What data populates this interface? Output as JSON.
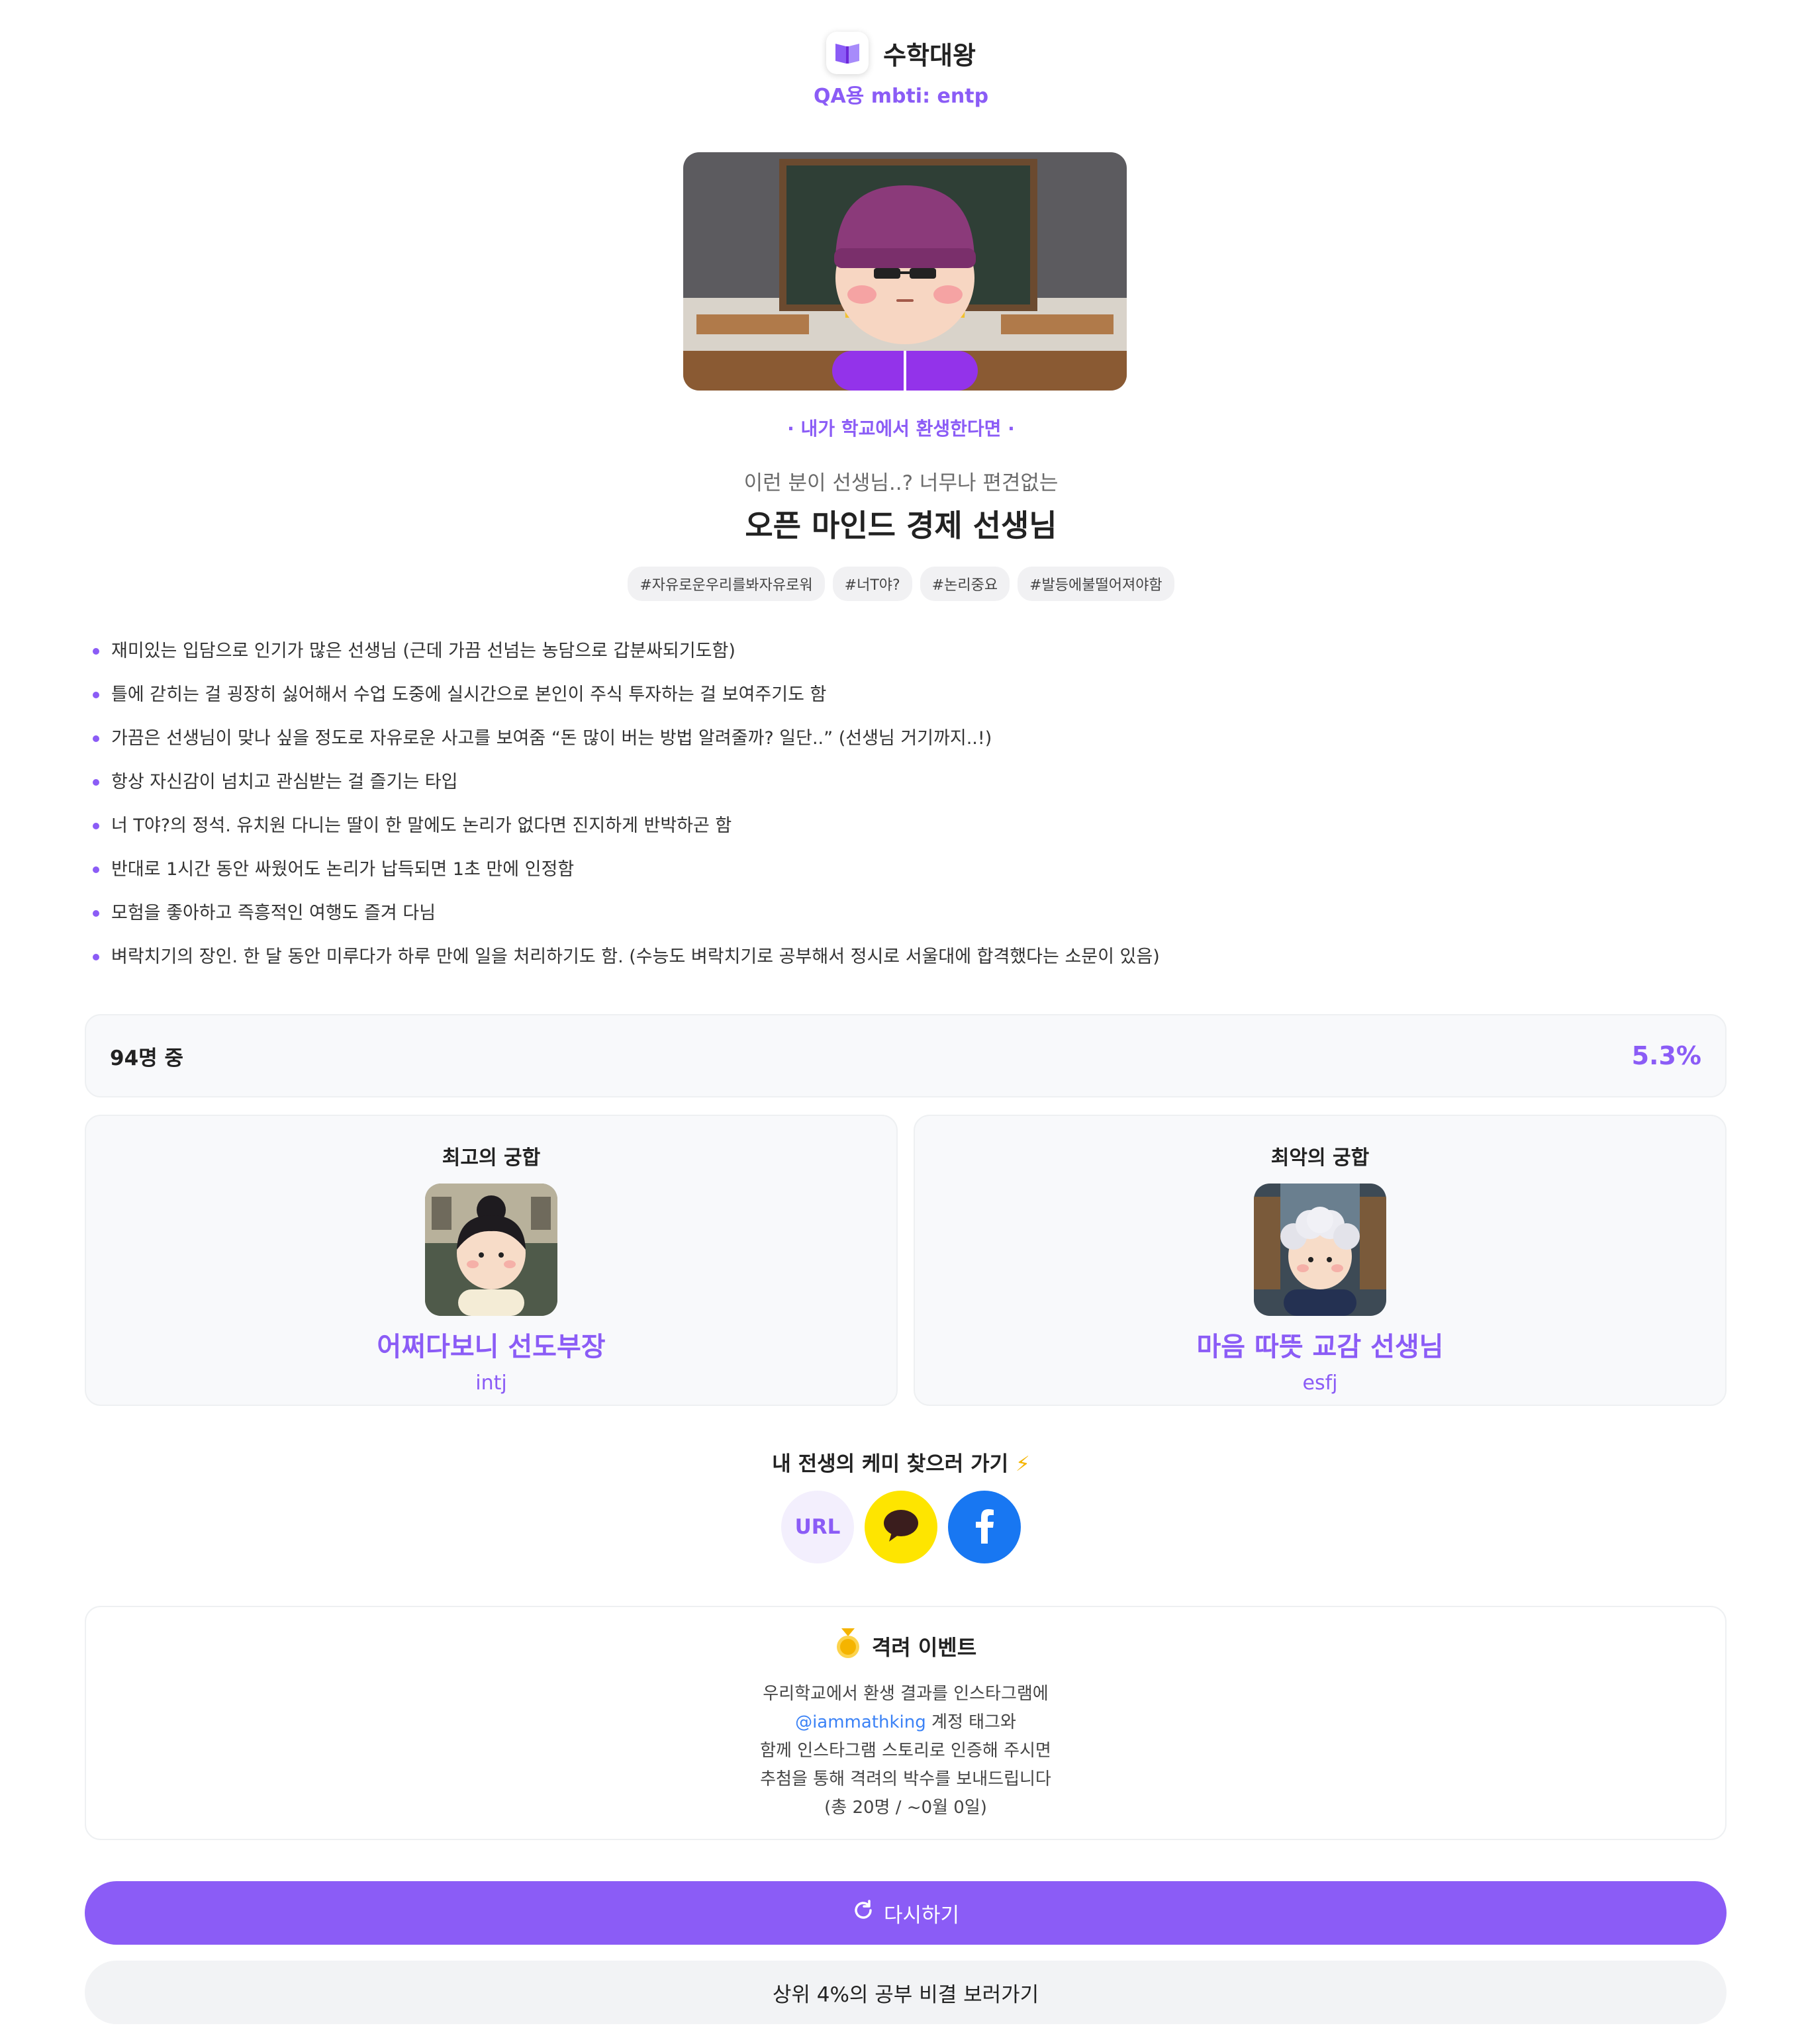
{
  "header": {
    "app_name": "수학대왕",
    "subtitle": "QA용 mbti: entp",
    "logo_icon": "open-book-icon"
  },
  "hero": {
    "image": "teacher-character-illustration",
    "accent_color": "#8b5cf6"
  },
  "result": {
    "context": "· 내가 학교에서 환생한다면 ·",
    "pretitle": "이런 분이 선생님..? 너무나 편견없는",
    "title": "오픈 마인드 경제 선생님",
    "tags": [
      "#자유로운우리를봐자유로워",
      "#너T야?",
      "#논리중요",
      "#발등에불떨어져야함"
    ]
  },
  "traits": [
    "재미있는 입담으로 인기가 많은 선생님 (근데 가끔 선넘는 농담으로 갑분싸되기도함)",
    "틀에 갇히는 걸 굉장히 싫어해서 수업 도중에 실시간으로 본인이 주식 투자하는 걸 보여주기도 함",
    "가끔은 선생님이 맞나 싶을 정도로 자유로운 사고를 보여줌 “돈 많이 버는 방법 알려줄까? 일단..” (선생님 거기까지..!)",
    "항상 자신감이 넘치고 관심받는 걸 즐기는 타입",
    "너 T야?의 정석. 유치원 다니는 딸이 한 말에도 논리가 없다면 진지하게 반박하곤 함",
    "반대로 1시간 동안 싸웠어도 논리가 납득되면 1초 만에 인정함",
    "모험을 좋아하고 즉흥적인 여행도 즐겨 다님",
    "벼락치기의 장인. 한 달 동안 미루다가 하루 만에 일을 처리하기도 함. (수능도 벼락치기로 공부해서 정시로 서울대에 합격했다는 소문이 있음)"
  ],
  "stats": {
    "count_label": "94명 중",
    "percent": "5.3%"
  },
  "matches": {
    "best": {
      "label": "최고의 궁합",
      "name": "어쩌다보니 선도부장",
      "type": "intj"
    },
    "worst": {
      "label": "최악의 궁합",
      "name": "마음 따뜻 교감 선생님",
      "type": "esfj"
    }
  },
  "share": {
    "title": "내 전생의 케미 찾으러 가기",
    "bolt_icon": "lightning-icon",
    "url_label": "URL",
    "kakao_color": "#fee500",
    "facebook_color": "#1877f2"
  },
  "event": {
    "icon": "medal-icon",
    "title": "격려 이벤트",
    "line1": "우리학교에서 환생 결과를 인스타그램에",
    "handle": "@iammathking",
    "line2_suffix": " 계정 태그와",
    "line3": "함께 인스타그램 스토리로 인증해 주시면",
    "line4": "추첨을 통해 격려의 박수를 보내드립니다",
    "line5": "(총 20명 / ~0월 0일)"
  },
  "actions": {
    "restart_label": "다시하기",
    "restart_icon": "refresh-icon",
    "secret_label": "상위 4%의 공부 비결 보러가기"
  }
}
